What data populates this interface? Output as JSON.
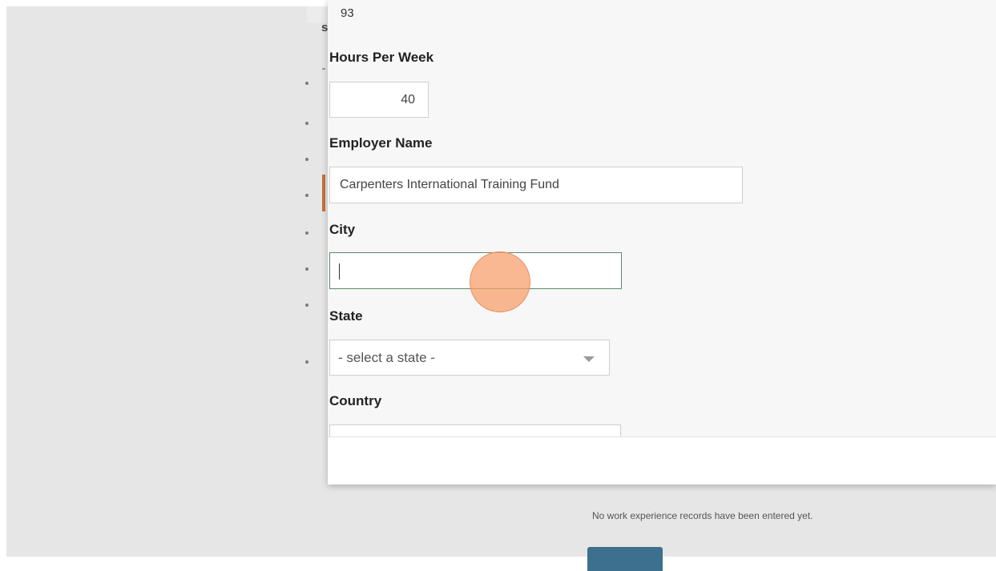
{
  "form": {
    "previous_value": "93",
    "hours_label": "Hours Per Week",
    "hours_value": "40",
    "employer_label": "Employer Name",
    "employer_value": "Carpenters International Training Fund",
    "city_label": "City",
    "city_value": "",
    "state_label": "State",
    "state_selected": "- select a state -",
    "country_label": "Country"
  },
  "page": {
    "empty_message": "No work experience records have been entered yet."
  },
  "colors": {
    "accent": "#c7703b",
    "click_indicator": "#f7a06c",
    "button": "#3d6f8e"
  }
}
